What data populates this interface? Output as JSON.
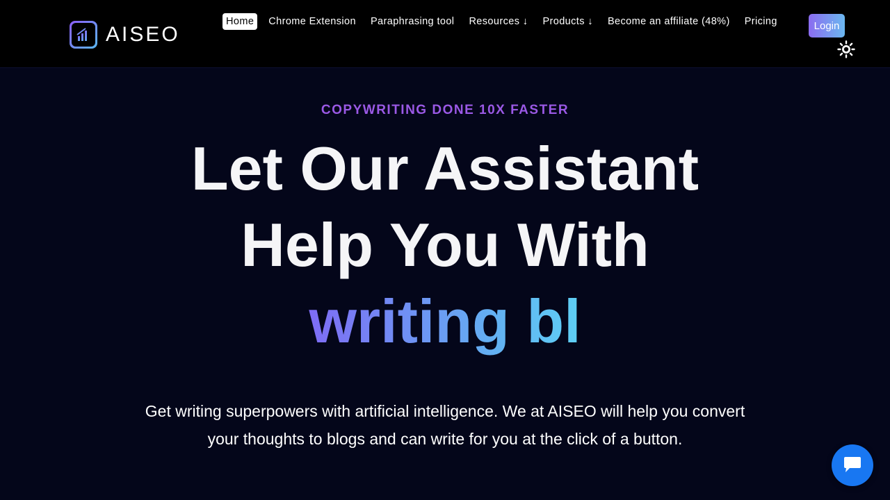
{
  "header": {
    "logo_text": "AISEO",
    "nav": [
      {
        "label": "Home",
        "active": true
      },
      {
        "label": "Chrome Extension"
      },
      {
        "label": "Paraphrasing tool"
      },
      {
        "label": "Resources ↓"
      },
      {
        "label": "Products ↓"
      },
      {
        "label": "Become an affiliate (48%)"
      },
      {
        "label": "Pricing"
      }
    ],
    "login_label": "Login",
    "theme_icon": "sun-icon"
  },
  "hero": {
    "eyebrow": "COPYWRITING DONE 10X FASTER",
    "headline_line1": "Let Our Assistant",
    "headline_line2": "Help You With",
    "typed_text": "writing bl",
    "subtitle": "Get writing superpowers with artificial intelligence. We at AISEO will help you convert your thoughts to blogs and can write for you at the click of a button."
  },
  "chat": {
    "icon": "chat-bubble-icon"
  },
  "colors": {
    "background": "#04061a",
    "header_background": "#000000",
    "eyebrow": "#9b59e6",
    "gradient_start": "#7e6cf5",
    "gradient_end": "#5fd0f5",
    "chat_button": "#1877f2"
  }
}
